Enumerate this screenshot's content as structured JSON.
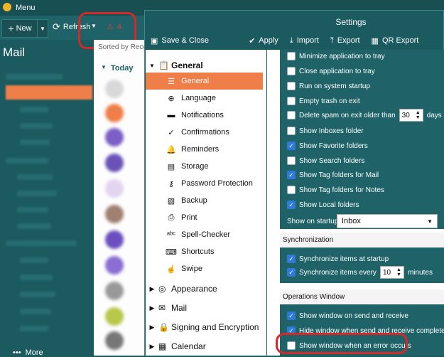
{
  "app": {
    "menu_label": "Menu"
  },
  "toolbar": {
    "new_label": "New",
    "refresh_label": "Refresh",
    "warning_count": "4"
  },
  "nav": {
    "title": "Mail",
    "more_label": "More"
  },
  "msglist": {
    "sorted_label": "Sorted by Received",
    "today_label": "Today"
  },
  "settings": {
    "title": "Settings",
    "toolbar": {
      "save_close": "Save & Close",
      "apply": "Apply",
      "import": "Import",
      "export": "Export",
      "qr_export": "QR Export"
    },
    "tree": {
      "general": "General",
      "items": [
        "General",
        "Language",
        "Notifications",
        "Confirmations",
        "Reminders",
        "Storage",
        "Password Protection",
        "Backup",
        "Print",
        "Spell-Checker",
        "Shortcuts",
        "Swipe"
      ],
      "appearance": "Appearance",
      "mail": "Mail",
      "signing": "Signing and Encryption",
      "calendar": "Calendar"
    },
    "options": {
      "minimize_tray": "Minimize application to tray",
      "close_tray": "Close application to tray",
      "run_startup": "Run on system startup",
      "empty_trash": "Empty trash on exit",
      "delete_spam": "Delete spam on exit older than",
      "delete_spam_value": "30",
      "days": "days",
      "show_inboxes": "Show Inboxes folder",
      "show_favorite": "Show Favorite folders",
      "show_search": "Show Search folders",
      "show_tag_mail": "Show Tag folders for Mail",
      "show_tag_notes": "Show Tag folders for Notes",
      "show_local": "Show Local folders",
      "show_on_startup": "Show on startup:",
      "startup_value": "Inbox"
    },
    "sync": {
      "header": "Synchronization",
      "at_startup": "Synchronize items at startup",
      "every": "Synchronize items every",
      "every_value": "10",
      "minutes": "minutes"
    },
    "ops": {
      "header": "Operations Window",
      "show_send_receive": "Show window on send and receive",
      "hide_complete": "Hide window when send and receive completes",
      "show_error": "Show window when an error occurs"
    }
  }
}
